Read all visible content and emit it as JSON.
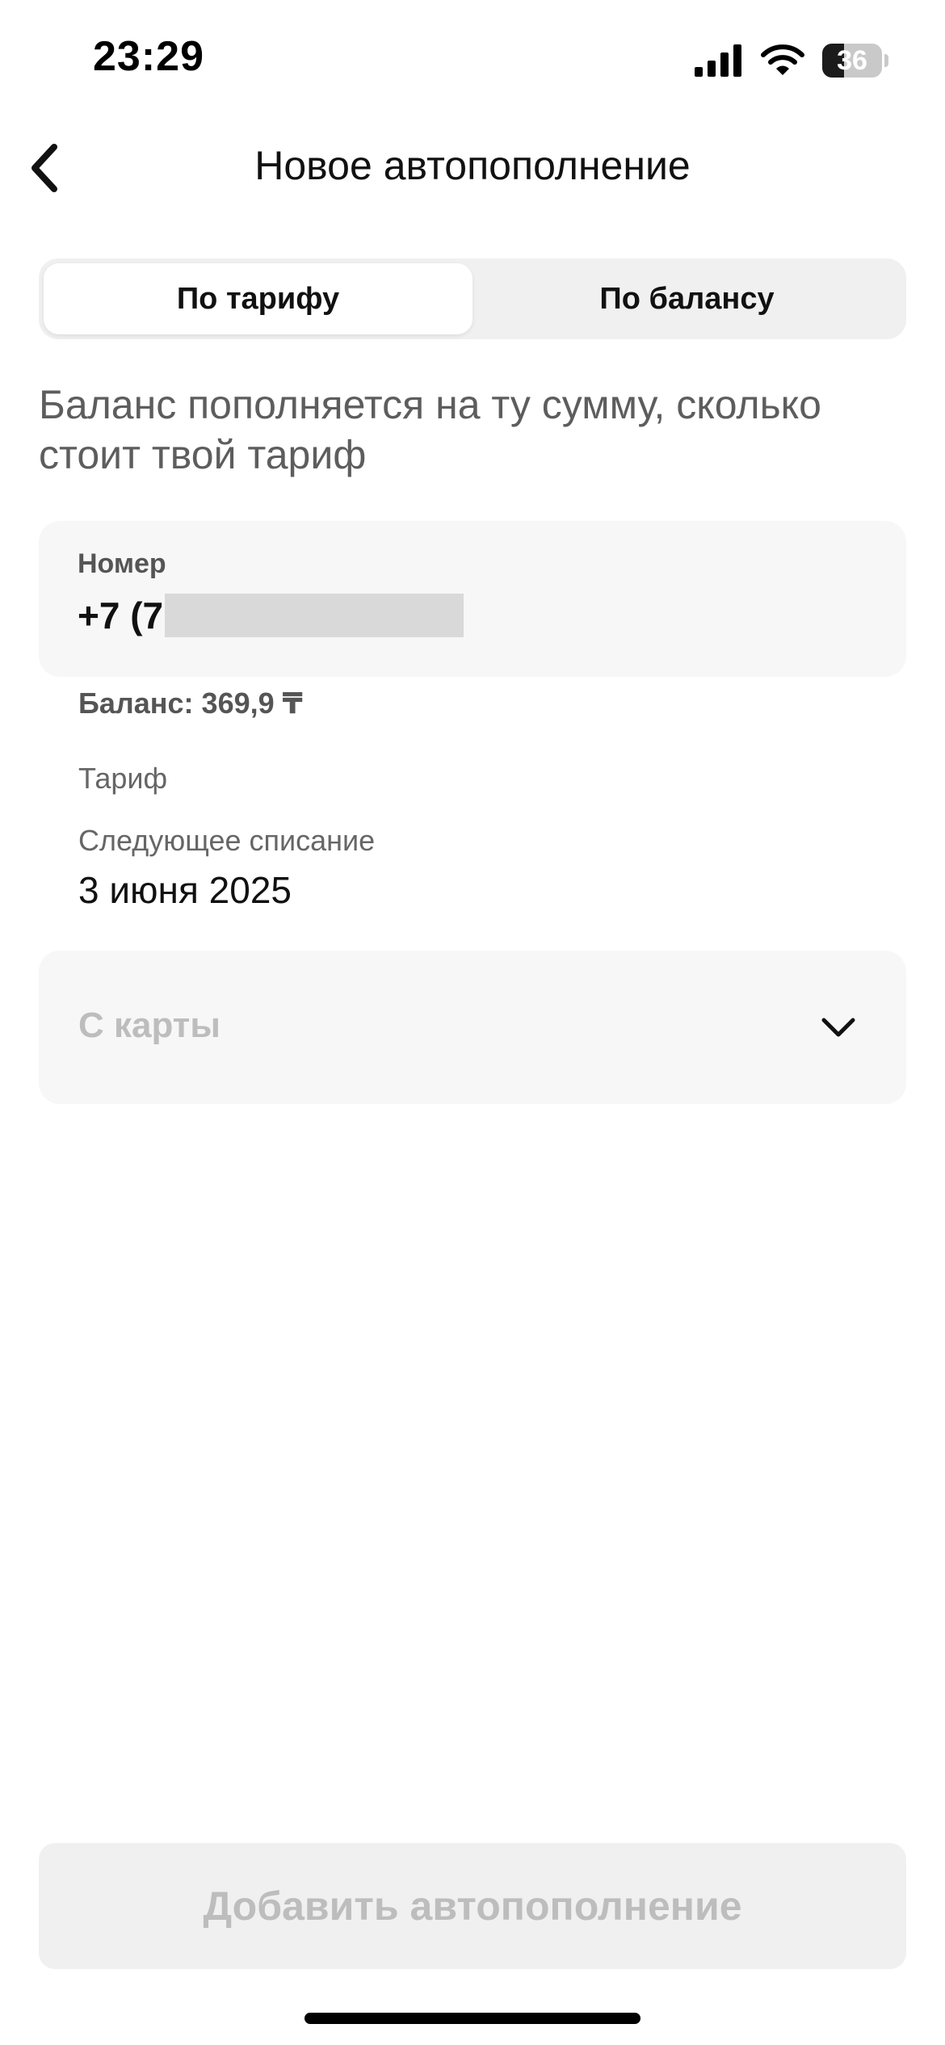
{
  "status_bar": {
    "time": "23:29",
    "battery_level": "36",
    "battery_fraction": 0.36,
    "icons": [
      "signal-icon",
      "wifi-icon",
      "battery-icon"
    ]
  },
  "header": {
    "back_icon": "chevron-left-icon",
    "title": "Новое автопополнение"
  },
  "tabs": [
    {
      "label": "По тарифу",
      "active": true
    },
    {
      "label": "По балансу",
      "active": false
    }
  ],
  "description": "Баланс пополняется на ту сумму, сколько стоит твой тариф",
  "number_card": {
    "label": "Номер",
    "value_prefix": "+7 (7"
  },
  "balance_text": "Баланс: 369,9 ₸",
  "tariff_label": "Тариф",
  "next_charge": {
    "label": "Следующее списание",
    "value": "3 июня 2025"
  },
  "payment_source": {
    "placeholder": "С карты",
    "icon": "chevron-down-icon"
  },
  "submit_button": {
    "label": "Добавить автопополнение",
    "enabled": false
  },
  "colors": {
    "background": "#ffffff",
    "card": "#f7f7f7",
    "segment_bg": "#f0f0f0",
    "text_primary": "#111111",
    "text_secondary": "#5d5d5d",
    "disabled_text": "#bdbdbd"
  }
}
